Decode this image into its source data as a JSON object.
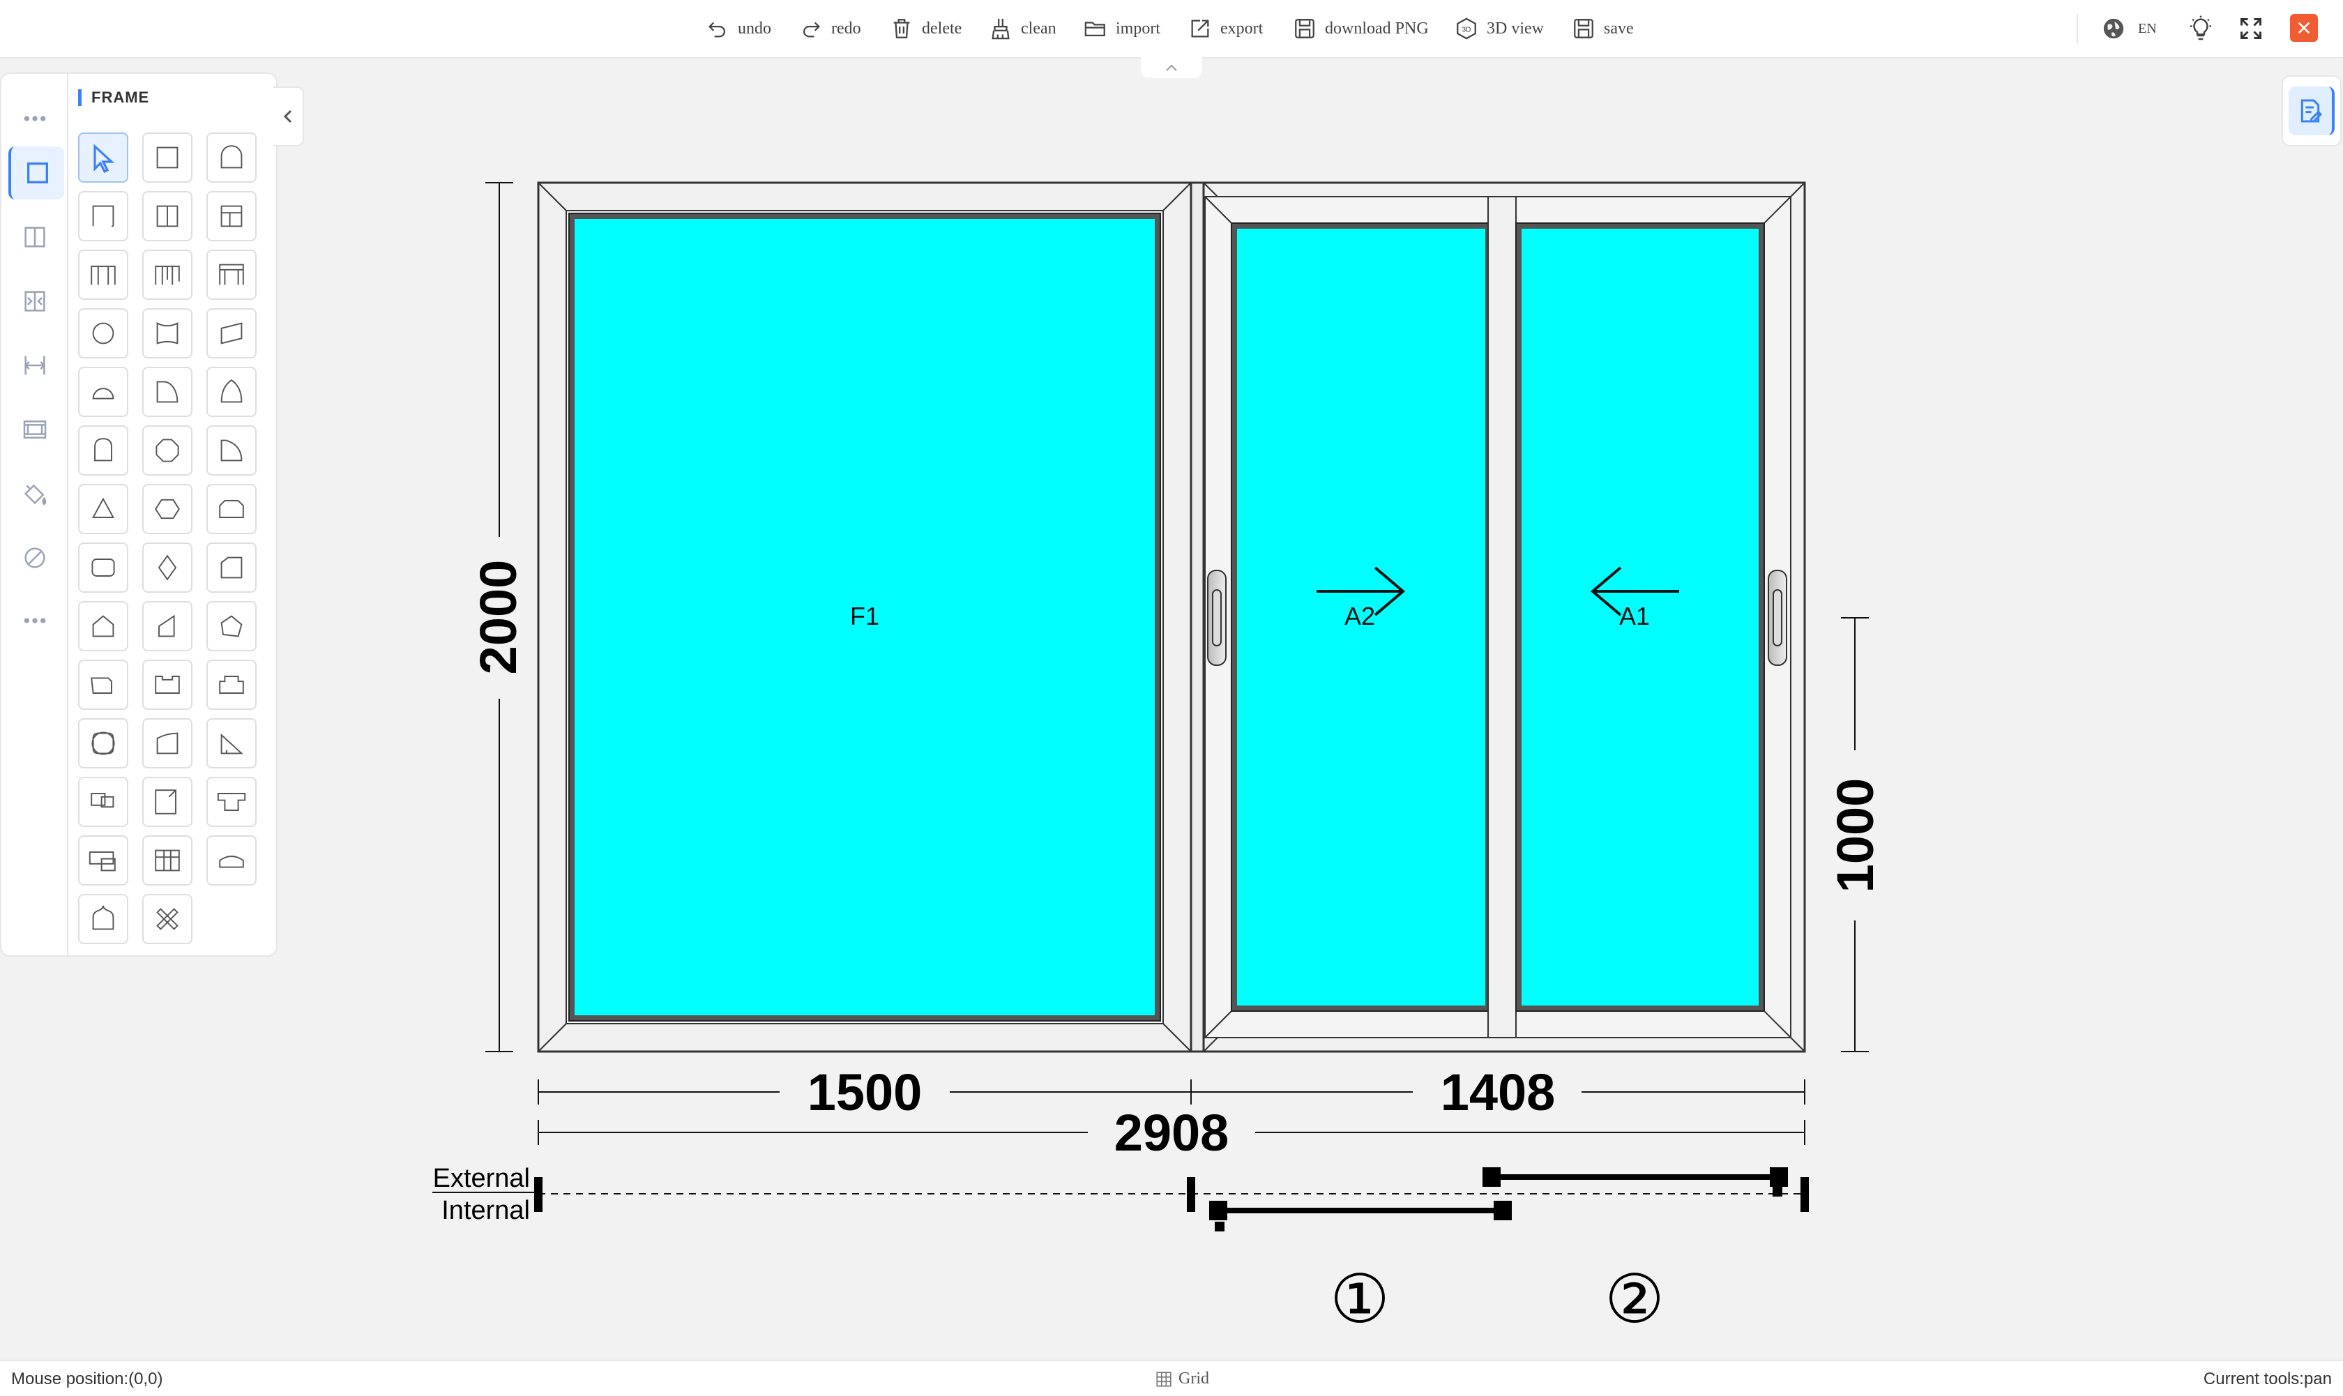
{
  "toolbar": {
    "undo": "undo",
    "redo": "redo",
    "delete": "delete",
    "clean": "clean",
    "import": "import",
    "export": "export",
    "download_png": "download PNG",
    "view_3d": "3D view",
    "save": "save",
    "language": "EN"
  },
  "panel": {
    "title": "FRAME",
    "shapes": [
      "select-tool",
      "rectangle",
      "arch-top",
      "frame-corner",
      "frame-mullion",
      "frame-transom",
      "frame-double",
      "frame-twin",
      "frame-portal",
      "circle",
      "curved-top",
      "trapezoid",
      "half-round",
      "quarter-round",
      "gothic-arch",
      "round-top-narrow",
      "octagon",
      "quarter-arch",
      "triangle",
      "hexagon",
      "trapezoid-top",
      "rounded-rect",
      "diamond",
      "slanted-corner",
      "pentagon",
      "slanted-side",
      "irregular-pentagon",
      "notched-rect",
      "stepped-top",
      "tab-top",
      "quatrefoil",
      "curved-parallelogram",
      "right-triangle",
      "offset-combo",
      "tall-combo",
      "t-combo",
      "bay-combo",
      "grid-combo",
      "segment-arch",
      "ogee-arch",
      "custom-tools"
    ]
  },
  "drawing": {
    "panes": {
      "fixed": "F1",
      "sash_2": "A2",
      "sash_1": "A1"
    },
    "dims": {
      "height": "2000",
      "fixed_width": "1500",
      "sliding_width": "1408",
      "total_width": "2908",
      "partial_height": "1000"
    },
    "track_labels": {
      "external": "External",
      "internal": "Internal"
    },
    "track_numbers": [
      "①",
      "②"
    ],
    "glass_color": "#00ffff"
  },
  "status": {
    "mouse": "Mouse position:(0,0)",
    "grid": "Grid",
    "tool": "Current tools:pan"
  },
  "colors": {
    "accent": "#3b82f6",
    "close": "#f25c33"
  }
}
